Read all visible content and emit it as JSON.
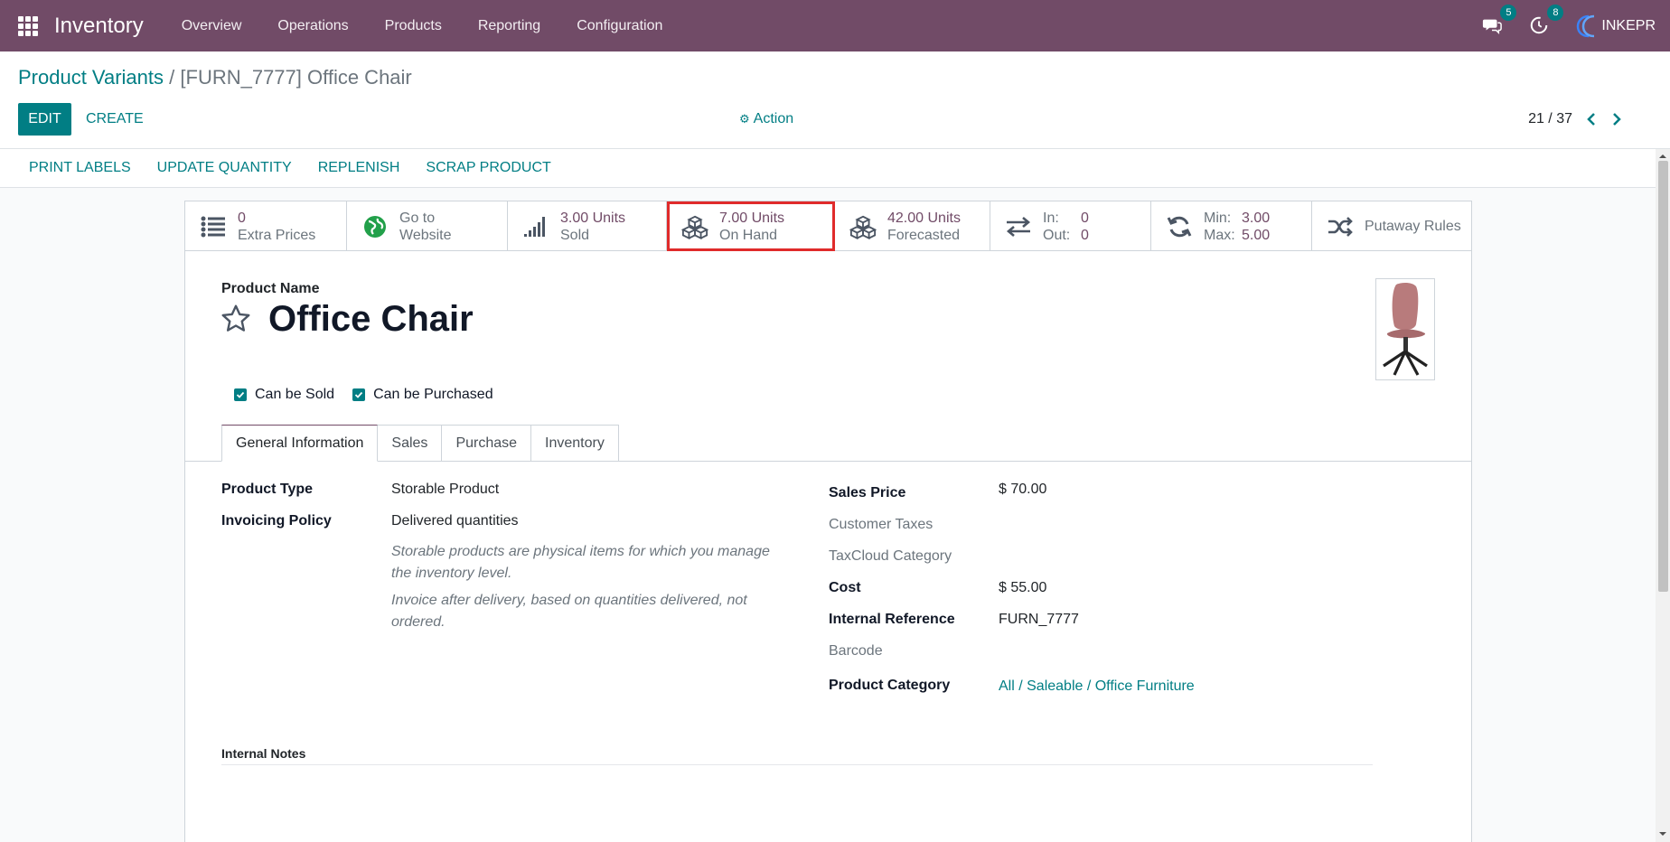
{
  "navbar": {
    "app_name": "Inventory",
    "menu": [
      "Overview",
      "Operations",
      "Products",
      "Reporting",
      "Configuration"
    ],
    "messages_badge": "5",
    "activities_badge": "8",
    "company": "INKEPR"
  },
  "breadcrumb": {
    "parent": "Product Variants",
    "separator": "/",
    "current": "[FURN_7777] Office Chair"
  },
  "control": {
    "edit": "EDIT",
    "create": "CREATE",
    "action": "Action",
    "pager": "21 / 37"
  },
  "header_actions": [
    "PRINT LABELS",
    "UPDATE QUANTITY",
    "REPLENISH",
    "SCRAP PRODUCT"
  ],
  "smart_buttons": {
    "extra_prices": {
      "value": "0",
      "label": "Extra Prices"
    },
    "website": {
      "line1": "Go to",
      "line2": "Website"
    },
    "sold": {
      "value": "3.00 Units",
      "label": "Sold"
    },
    "on_hand": {
      "value": "7.00 Units",
      "label": "On Hand"
    },
    "forecasted": {
      "value": "42.00 Units",
      "label": "Forecasted"
    },
    "in_out": {
      "in_label": "In:",
      "in_value": "0",
      "out_label": "Out:",
      "out_value": "0"
    },
    "min_max": {
      "min_label": "Min:",
      "min_value": "3.00",
      "max_label": "Max:",
      "max_value": "5.00"
    },
    "putaway": {
      "label": "Putaway Rules"
    }
  },
  "form": {
    "product_name_label": "Product Name",
    "product_name": "Office Chair",
    "can_be_sold": "Can be Sold",
    "can_be_purchased": "Can be Purchased",
    "tabs": [
      "General Information",
      "Sales",
      "Purchase",
      "Inventory"
    ],
    "left": {
      "product_type_label": "Product Type",
      "product_type": "Storable Product",
      "invoicing_policy_label": "Invoicing Policy",
      "invoicing_policy": "Delivered quantities",
      "help_type": "Storable products are physical items for which you manage the inventory level.",
      "help_invoice": "Invoice after delivery, based on quantities delivered, not ordered."
    },
    "right": {
      "sales_price_label": "Sales Price",
      "sales_price": "$ 70.00",
      "customer_taxes_label": "Customer Taxes",
      "taxcloud_label": "TaxCloud Category",
      "cost_label": "Cost",
      "cost": "$ 55.00",
      "internal_ref_label": "Internal Reference",
      "internal_ref": "FURN_7777",
      "barcode_label": "Barcode",
      "category_label": "Product Category",
      "category": "All / Saleable / Office Furniture"
    },
    "internal_notes_label": "Internal Notes"
  },
  "colors": {
    "brand": "#714B67",
    "accent": "#017E84",
    "highlight": "#e02b2b"
  }
}
